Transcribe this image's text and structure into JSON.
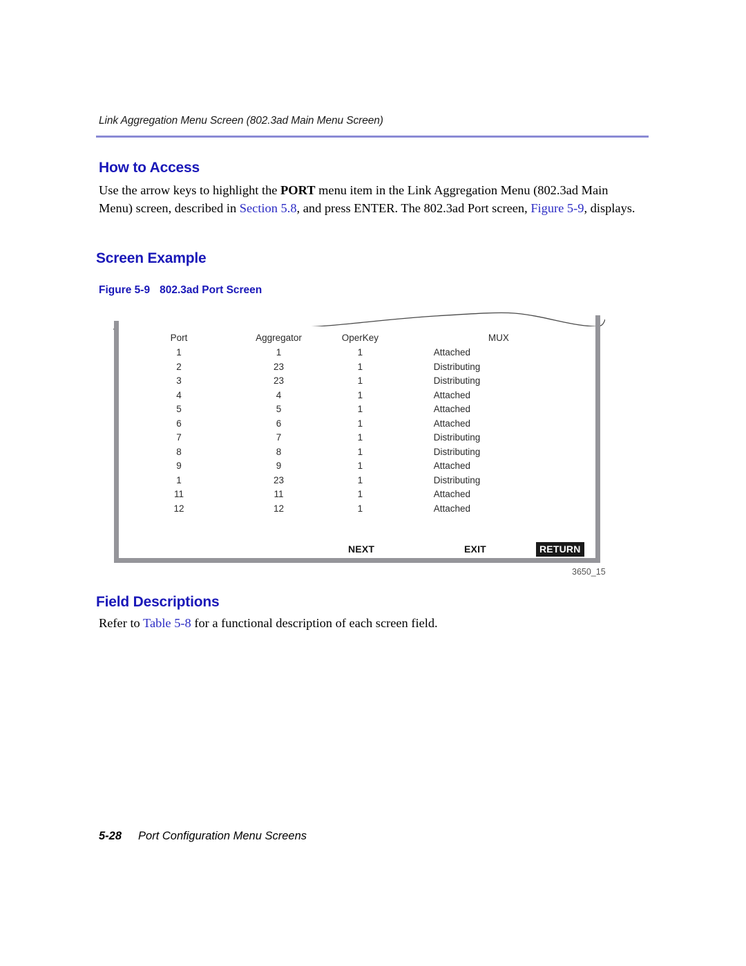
{
  "header": {
    "running_title": "Link Aggregation Menu Screen (802.3ad Main Menu Screen)",
    "rule_color": "#8a8ad4"
  },
  "colors": {
    "heading_blue": "#1a18b8",
    "link_blue": "#2b2bc4",
    "frame_gray": "#95959a",
    "highlight_bg": "#1a1a1a"
  },
  "sections": {
    "how_to_access": {
      "heading": "How to Access",
      "paragraph": {
        "part1": "Use the arrow keys to highlight the ",
        "bold1": "PORT",
        "part2": " menu item in the Link Aggregation Menu (802.3ad Main Menu) screen, described in ",
        "link1": "Section 5.8",
        "part3": ", and press ENTER. The 802.3ad Port screen, ",
        "link2": "Figure 5-9",
        "part4": ", displays."
      }
    },
    "screen_example": {
      "heading": "Screen Example",
      "figure_caption": {
        "number": "Figure 5-9",
        "title": "802.3ad Port Screen"
      },
      "figure_id": "3650_15"
    },
    "field_descriptions": {
      "heading": "Field Descriptions",
      "paragraph": {
        "part1": "Refer to ",
        "link1": "Table 5-8",
        "part2": " for a functional description of each screen field."
      }
    }
  },
  "screen": {
    "columns": [
      "Port",
      "Aggregator",
      "OperKey",
      "MUX"
    ],
    "rows": [
      {
        "port": "1",
        "aggregator": "1",
        "operkey": "1",
        "mux": "Attached"
      },
      {
        "port": "2",
        "aggregator": "23",
        "operkey": "1",
        "mux": "Distributing"
      },
      {
        "port": "3",
        "aggregator": "23",
        "operkey": "1",
        "mux": "Distributing"
      },
      {
        "port": "4",
        "aggregator": "4",
        "operkey": "1",
        "mux": "Attached"
      },
      {
        "port": "5",
        "aggregator": "5",
        "operkey": "1",
        "mux": "Attached"
      },
      {
        "port": "6",
        "aggregator": "6",
        "operkey": "1",
        "mux": "Attached"
      },
      {
        "port": "7",
        "aggregator": "7",
        "operkey": "1",
        "mux": "Distributing"
      },
      {
        "port": "8",
        "aggregator": "8",
        "operkey": "1",
        "mux": "Distributing"
      },
      {
        "port": "9",
        "aggregator": "9",
        "operkey": "1",
        "mux": "Attached"
      },
      {
        "port": "1",
        "aggregator": "23",
        "operkey": "1",
        "mux": "Distributing"
      },
      {
        "port": "11",
        "aggregator": "11",
        "operkey": "1",
        "mux": "Attached"
      },
      {
        "port": "12",
        "aggregator": "12",
        "operkey": "1",
        "mux": "Attached"
      }
    ],
    "buttons": [
      {
        "label": "NEXT",
        "selected": false
      },
      {
        "label": "EXIT",
        "selected": false
      },
      {
        "label": "RETURN",
        "selected": true
      }
    ]
  },
  "footer": {
    "page_number": "5-28",
    "text": "Port Configuration Menu Screens"
  }
}
